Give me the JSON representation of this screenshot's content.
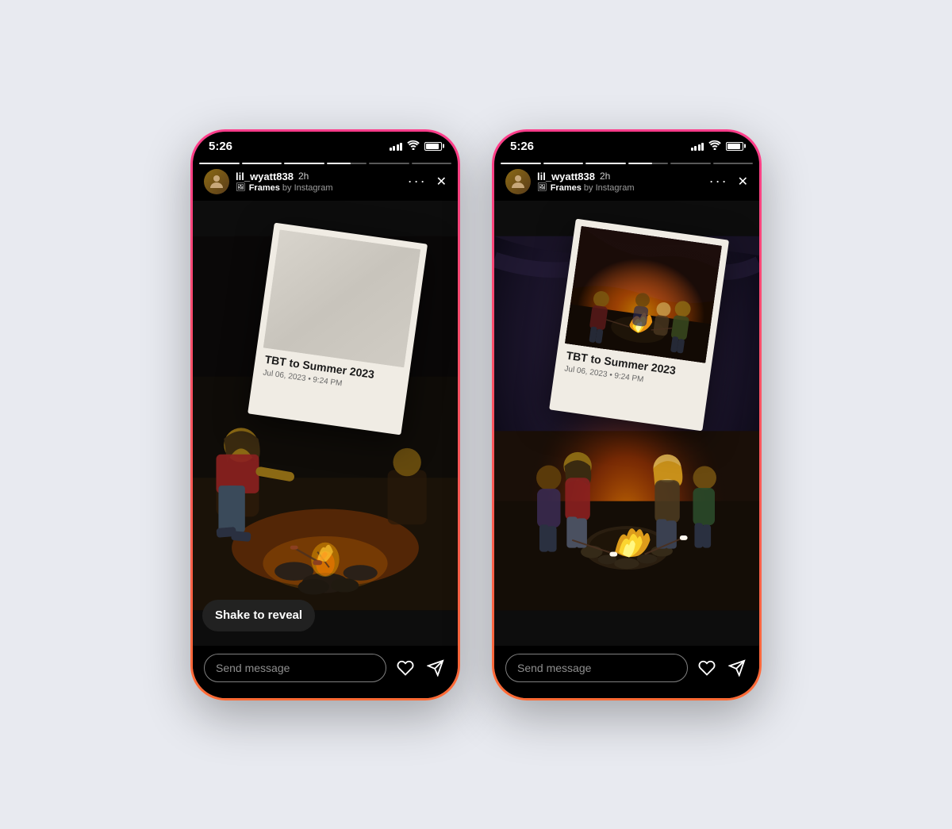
{
  "page": {
    "bg_color": "#e8eaf0"
  },
  "phones": [
    {
      "id": "phone-left",
      "status_bar": {
        "time": "5:26"
      },
      "story": {
        "username": "lil_wyatt838",
        "time_ago": "2h",
        "effect_name": "Frames",
        "effect_by": "by Instagram",
        "progress_segments": [
          1,
          1,
          1,
          0.6,
          0,
          0
        ]
      },
      "polaroid": {
        "title": "TBT to Summer 2023",
        "date": "Jul 06, 2023 • 9:24 PM",
        "revealed": false
      },
      "shake_label": "Shake to reveal",
      "message_placeholder": "Send message"
    },
    {
      "id": "phone-right",
      "status_bar": {
        "time": "5:26"
      },
      "story": {
        "username": "lil_wyatt838",
        "time_ago": "2h",
        "effect_name": "Frames",
        "effect_by": "by Instagram",
        "progress_segments": [
          1,
          1,
          1,
          0.6,
          0,
          0
        ]
      },
      "polaroid": {
        "title": "TBT to Summer 2023",
        "date": "Jul 06, 2023 • 9:24 PM",
        "revealed": true
      },
      "message_placeholder": "Send message"
    }
  ],
  "icons": {
    "more_dots": "···",
    "close": "✕",
    "heart": "♡",
    "send": "➤",
    "frames_emoji": "🖼"
  }
}
